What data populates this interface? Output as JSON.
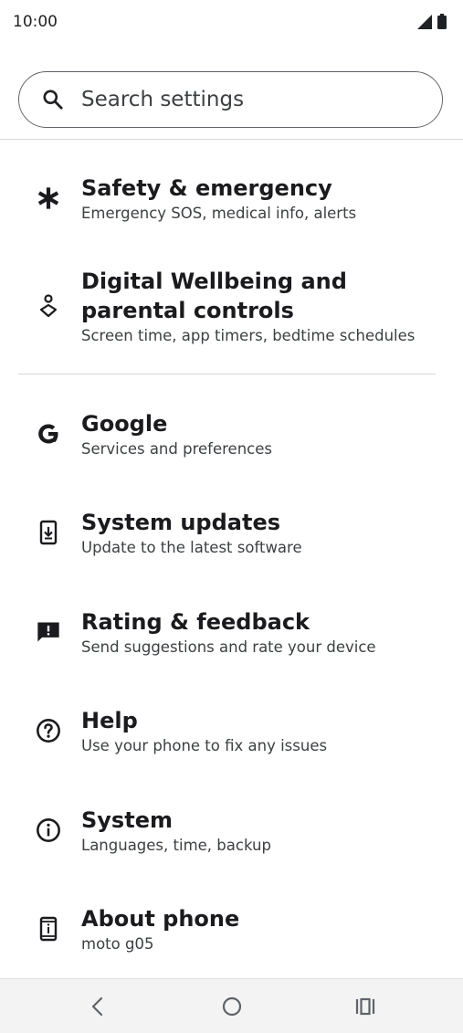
{
  "status_bar": {
    "time": "10:00"
  },
  "search": {
    "placeholder": "Search settings"
  },
  "items": [
    {
      "title": "Safety & emergency",
      "subtitle": "Emergency SOS, medical info, alerts",
      "icon": "asterisk-icon"
    },
    {
      "title": "Digital Wellbeing and parental controls",
      "subtitle": "Screen time, app timers, bedtime schedules",
      "icon": "wellbeing-icon"
    },
    {
      "title": "Google",
      "subtitle": "Services and preferences",
      "icon": "google-icon"
    },
    {
      "title": "System updates",
      "subtitle": "Update to the latest software",
      "icon": "system-update-icon"
    },
    {
      "title": "Rating & feedback",
      "subtitle": "Send suggestions and rate your device",
      "icon": "feedback-icon"
    },
    {
      "title": "Help",
      "subtitle": "Use your phone to fix any issues",
      "icon": "help-icon"
    },
    {
      "title": "System",
      "subtitle": "Languages, time, backup",
      "icon": "info-icon"
    },
    {
      "title": "About phone",
      "subtitle": "moto g05",
      "icon": "phone-info-icon"
    }
  ],
  "nav": {
    "back": "back-icon",
    "home": "home-icon",
    "recents": "recents-icon"
  }
}
